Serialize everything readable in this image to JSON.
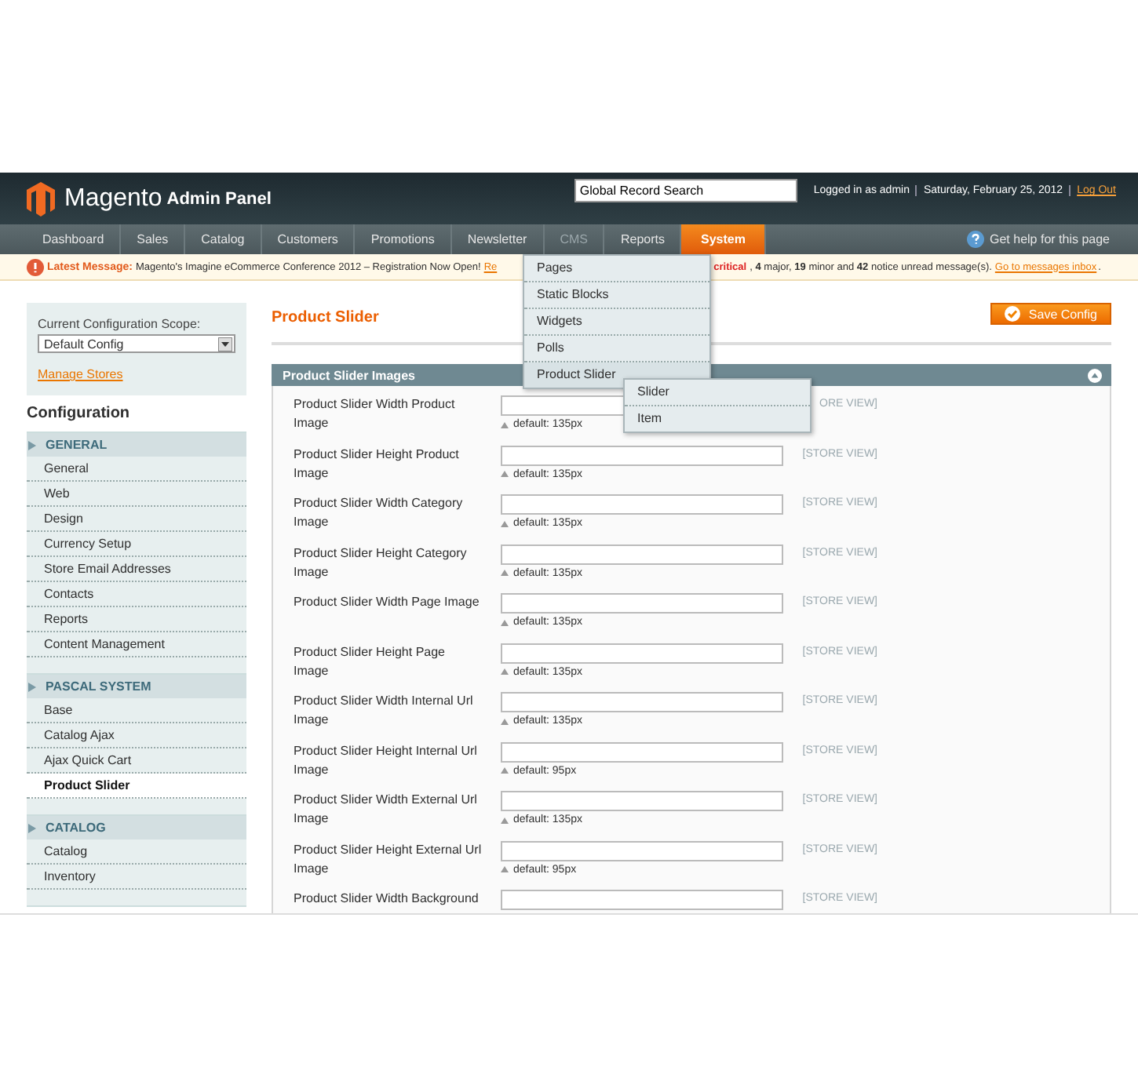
{
  "header": {
    "logo_text": "Magento",
    "logo_sub": "Admin Panel",
    "search": {
      "value": "Global Record Search"
    },
    "user_text": "Logged in as admin",
    "date": "Saturday, February 25, 2012",
    "logout": "Log Out"
  },
  "nav": {
    "items": [
      {
        "label": "Dashboard",
        "selected": false,
        "hovered": false
      },
      {
        "label": "Sales",
        "selected": false,
        "hovered": false
      },
      {
        "label": "Catalog",
        "selected": false,
        "hovered": false
      },
      {
        "label": "Customers",
        "selected": false,
        "hovered": false
      },
      {
        "label": "Promotions",
        "selected": false,
        "hovered": false
      },
      {
        "label": "Newsletter",
        "selected": false,
        "hovered": false
      },
      {
        "label": "CMS",
        "selected": false,
        "hovered": true
      },
      {
        "label": "Reports",
        "selected": false,
        "hovered": false
      },
      {
        "label": "System",
        "selected": true,
        "hovered": false
      }
    ],
    "help": "Get help for this page",
    "dropdown": {
      "items": [
        {
          "label": "Pages",
          "selected": false
        },
        {
          "label": "Static Blocks",
          "selected": false
        },
        {
          "label": "Widgets",
          "selected": false
        },
        {
          "label": "Polls",
          "selected": false
        },
        {
          "label": "Product Slider",
          "selected": true,
          "children": [
            {
              "label": "Slider"
            },
            {
              "label": "Item"
            }
          ]
        }
      ]
    }
  },
  "message": {
    "title": "Latest Message:",
    "text": "Magento's Imagine eCommerce Conference 2012 – Registration Now Open!",
    "link_fragment": "Re",
    "critical": "critical",
    "rest": ", **4** major, **19** minor and **42** notice unread message(s).",
    "inbox_link": "Go to messages inbox",
    "end_mark": "."
  },
  "sidebar": {
    "scope_label": "Current Configuration Scope:",
    "scope_value": "Default Config",
    "manage_stores": "Manage Stores",
    "title": "Configuration",
    "groups": [
      {
        "label": "GENERAL",
        "items": [
          {
            "label": "General",
            "selected": false
          },
          {
            "label": "Web",
            "selected": false
          },
          {
            "label": "Design",
            "selected": false
          },
          {
            "label": "Currency Setup",
            "selected": false
          },
          {
            "label": "Store Email Addresses",
            "selected": false
          },
          {
            "label": "Contacts",
            "selected": false
          },
          {
            "label": "Reports",
            "selected": false
          },
          {
            "label": "Content Management",
            "selected": false
          }
        ]
      },
      {
        "label": "PASCAL SYSTEM",
        "items": [
          {
            "label": "Base",
            "selected": false
          },
          {
            "label": "Catalog Ajax",
            "selected": false
          },
          {
            "label": "Ajax Quick Cart",
            "selected": false
          },
          {
            "label": "Product Slider",
            "selected": true
          }
        ]
      },
      {
        "label": "CATALOG",
        "items": [
          {
            "label": "Catalog",
            "selected": false
          },
          {
            "label": "Inventory",
            "selected": false
          }
        ]
      }
    ]
  },
  "main": {
    "title": "Product Slider",
    "save_button": "Save Config",
    "section_title": "Product Slider Images",
    "fields": [
      {
        "label": "Product Slider Width Product Image",
        "hint": "default: 135px",
        "scope": "ORE VIEW]"
      },
      {
        "label": "Product Slider Height Product Image",
        "hint": "default: 135px",
        "scope": "[STORE VIEW]"
      },
      {
        "label": "Product Slider Width Category Image",
        "hint": "default: 135px",
        "scope": "[STORE VIEW]"
      },
      {
        "label": "Product Slider Height Category Image",
        "hint": "default: 135px",
        "scope": "[STORE VIEW]"
      },
      {
        "label": "Product Slider Width Page Image",
        "hint": "default: 135px",
        "scope": "[STORE VIEW]"
      },
      {
        "label": "Product Slider Height Page Image",
        "hint": "default: 135px",
        "scope": "[STORE VIEW]"
      },
      {
        "label": "Product Slider Width Internal Url Image",
        "hint": "default: 135px",
        "scope": "[STORE VIEW]"
      },
      {
        "label": "Product Slider Height Internal Url Image",
        "hint": "default: 95px",
        "scope": "[STORE VIEW]"
      },
      {
        "label": "Product Slider Width External Url Image",
        "hint": "default: 135px",
        "scope": "[STORE VIEW]"
      },
      {
        "label": "Product Slider Height External Url Image",
        "hint": "default: 95px",
        "scope": "[STORE VIEW]"
      },
      {
        "label": "Product Slider Width Background",
        "scope": "[STORE VIEW]"
      }
    ]
  }
}
